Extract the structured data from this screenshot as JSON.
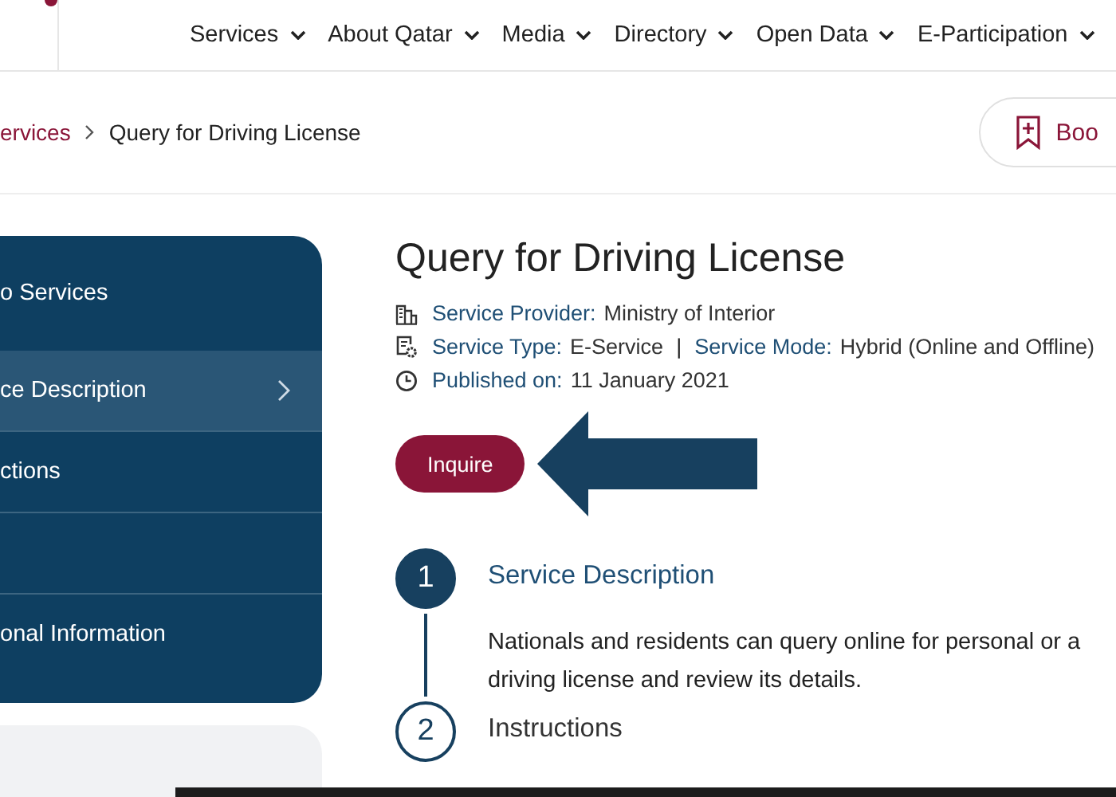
{
  "nav": {
    "items": [
      {
        "label": "Services"
      },
      {
        "label": "About Qatar"
      },
      {
        "label": "Media"
      },
      {
        "label": "Directory"
      },
      {
        "label": "Open Data"
      },
      {
        "label": "E-Participation"
      }
    ]
  },
  "breadcrumb": {
    "items": [
      {
        "label": "ervices",
        "kind": "link"
      },
      {
        "label": "Query for Driving License",
        "kind": "current"
      }
    ]
  },
  "bookmark_button": {
    "label": "Boo"
  },
  "sidebar": {
    "items": [
      {
        "label": "o Services",
        "selected": false
      },
      {
        "label": "ce Description",
        "selected": true
      },
      {
        "label": "ctions",
        "selected": false
      },
      {
        "selected": false
      },
      {
        "label": "onal Information",
        "selected": false
      }
    ]
  },
  "service": {
    "title": "Query for Driving License",
    "meta": [
      {
        "kind": "provider",
        "parts": [
          {
            "label": "Service Provider:",
            "value": "Ministry of Interior"
          }
        ]
      },
      {
        "kind": "type",
        "separator": "|",
        "parts": [
          {
            "label": "Service Type:",
            "value": "E-Service"
          },
          {
            "label": "Service Mode:",
            "value": "Hybrid (Online and Offline)"
          }
        ]
      },
      {
        "kind": "date",
        "parts": [
          {
            "label": "Published on:",
            "value": "11 January 2021"
          }
        ]
      }
    ],
    "button": "Inquire"
  },
  "steps": [
    {
      "number": "1",
      "title": "Service Description",
      "active": true,
      "text": "Nationals and residents can query online for personal or a driving license and review its details."
    },
    {
      "number": "2",
      "title": "Instructions",
      "active": false
    }
  ]
}
